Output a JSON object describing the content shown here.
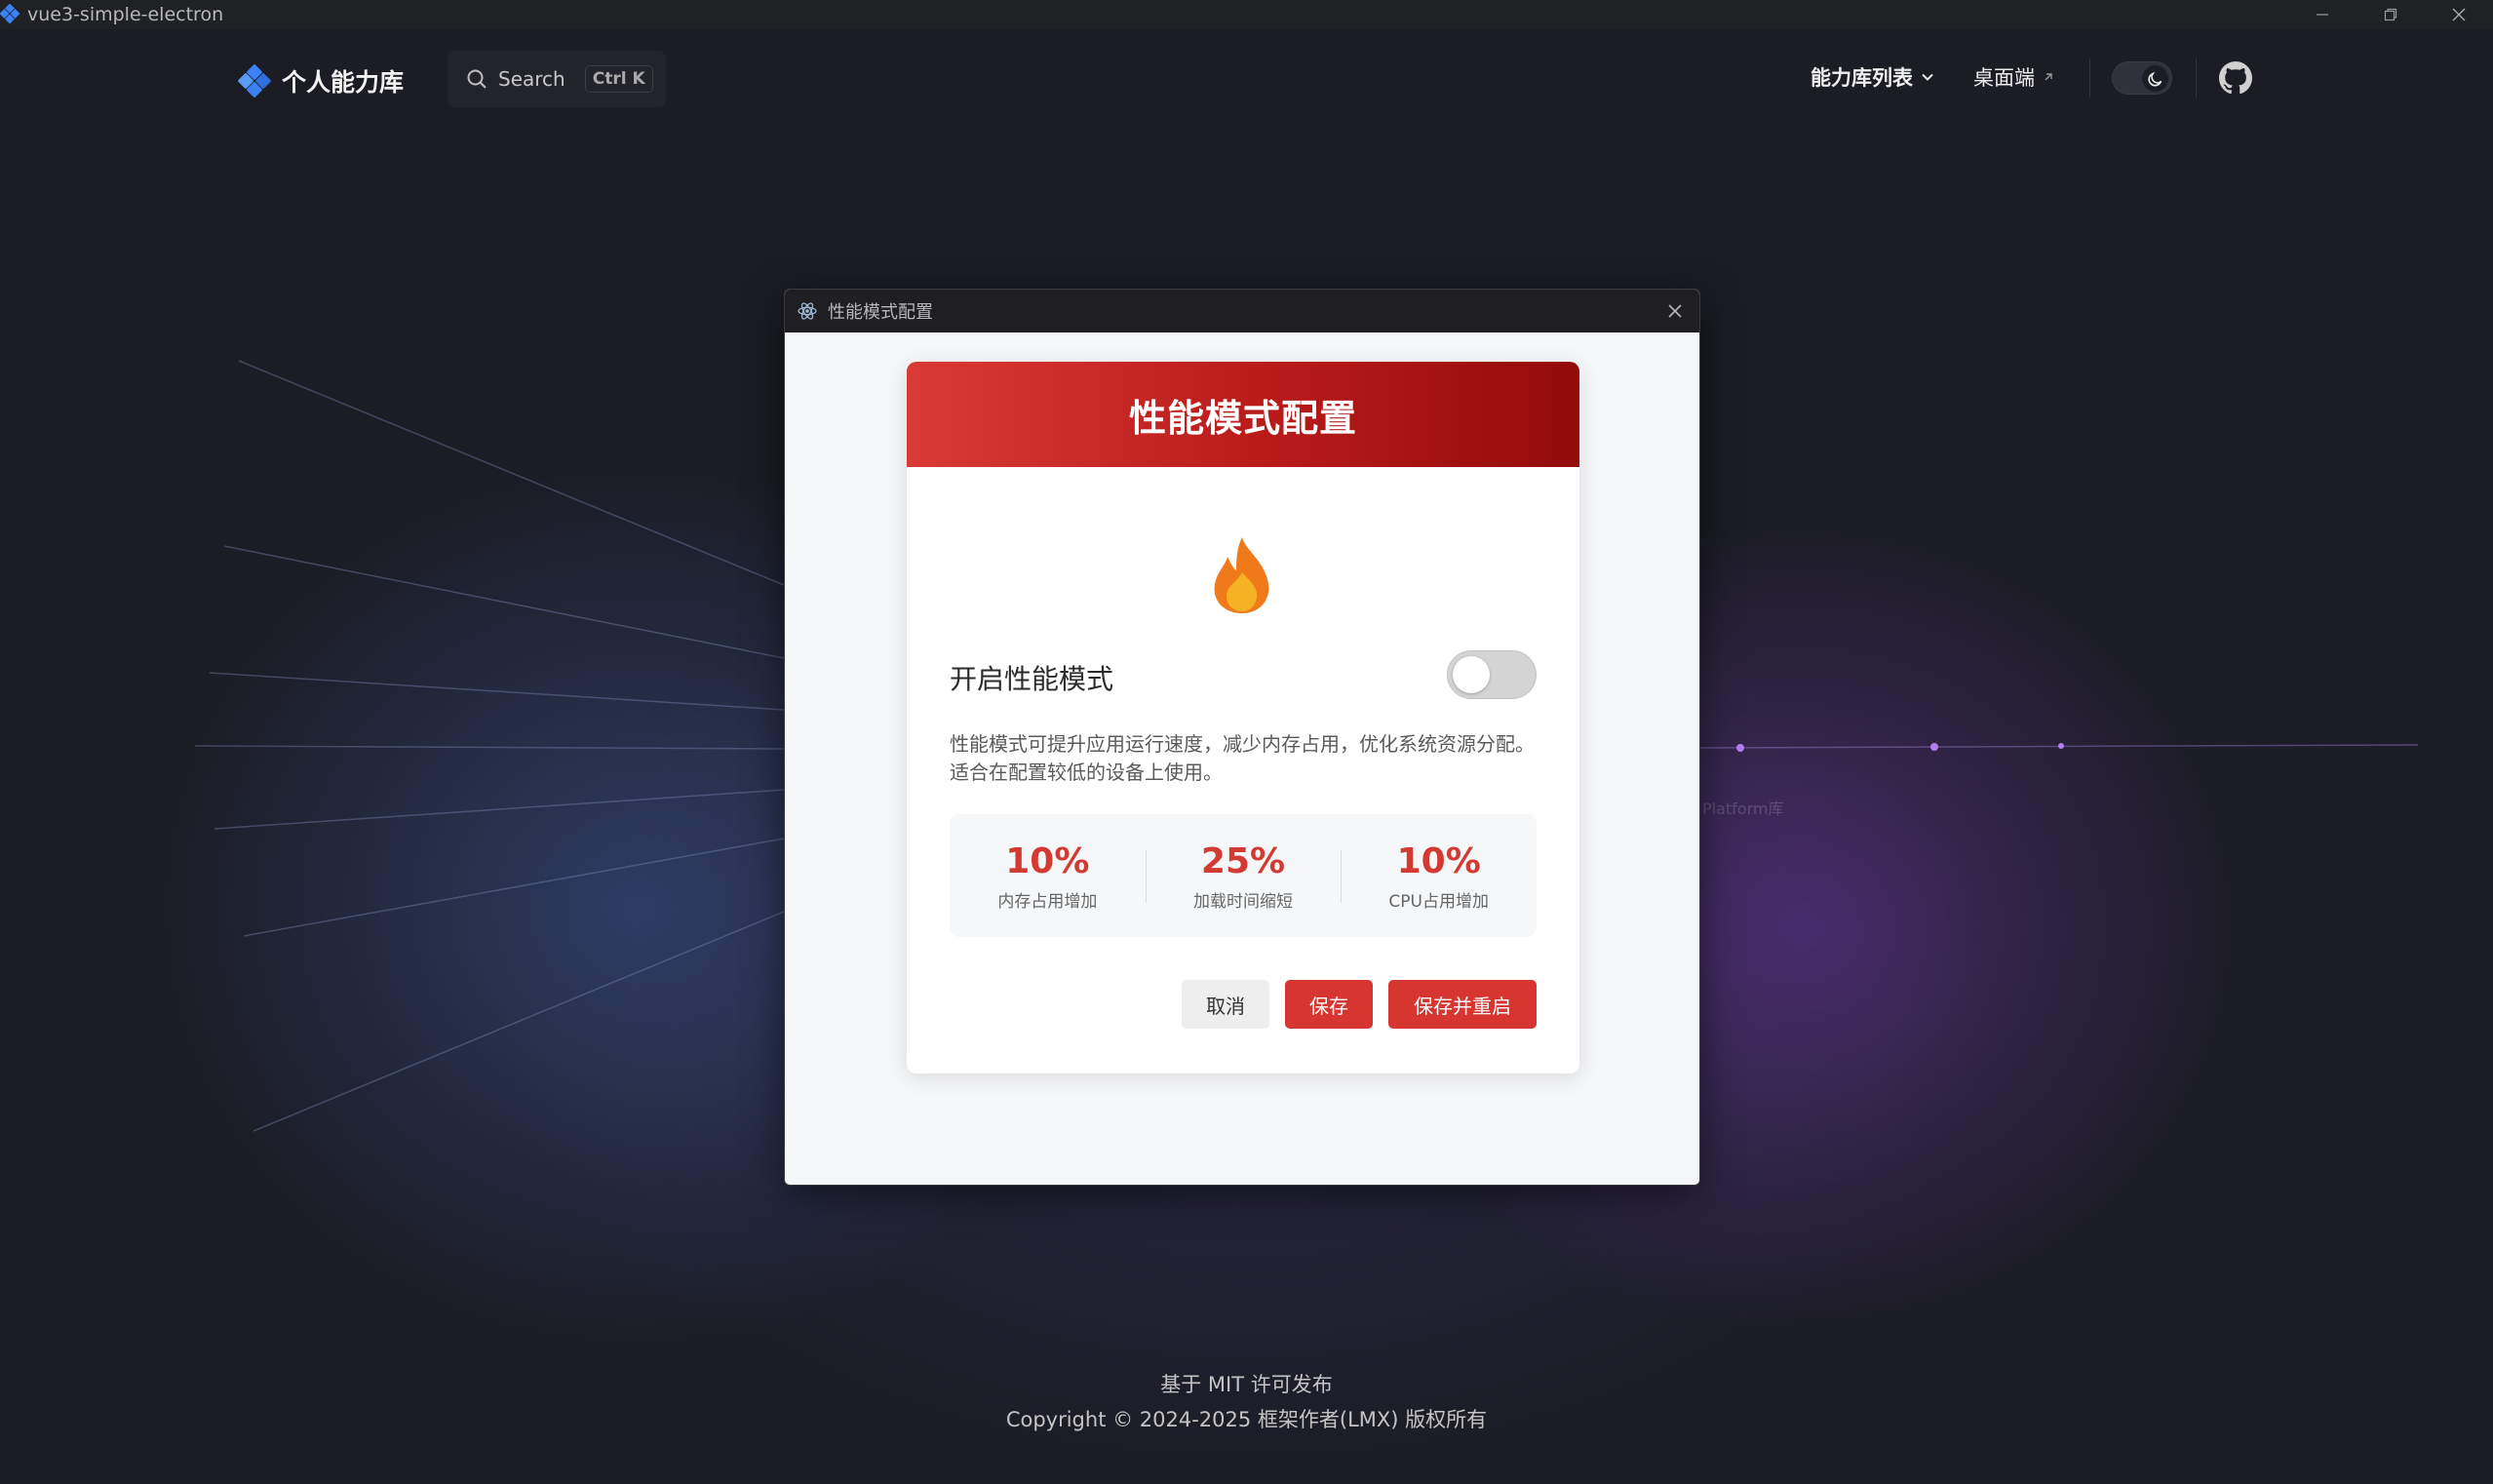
{
  "window": {
    "title": "vue3-simple-electron"
  },
  "nav": {
    "brand": "个人能力库",
    "search": {
      "label": "Search",
      "shortcut": "Ctrl K"
    },
    "menu_list": "能力库列表",
    "desktop": "桌面端"
  },
  "background": {
    "label": "Platform库"
  },
  "dialog": {
    "window_title": "性能模式配置",
    "header_title": "性能模式配置",
    "toggle_label": "开启性能模式",
    "toggle_on": false,
    "description": "性能模式可提升应用运行速度，减少内存占用，优化系统资源分配。适合在配置较低的设备上使用。",
    "stats": [
      {
        "value": "10%",
        "caption": "内存占用增加"
      },
      {
        "value": "25%",
        "caption": "加载时间缩短"
      },
      {
        "value": "10%",
        "caption": "CPU占用增加"
      }
    ],
    "buttons": {
      "cancel": "取消",
      "save": "保存",
      "save_restart": "保存并重启"
    }
  },
  "footer": {
    "license": "基于 MIT 许可发布",
    "copyright": "Copyright © 2024-2025 框架作者(LMX) 版权所有"
  },
  "colors": {
    "accent_red": "#d73530",
    "brand_blue": "#3b82f6",
    "flame_orange": "#f07a1a",
    "flame_yellow": "#f5b323"
  }
}
